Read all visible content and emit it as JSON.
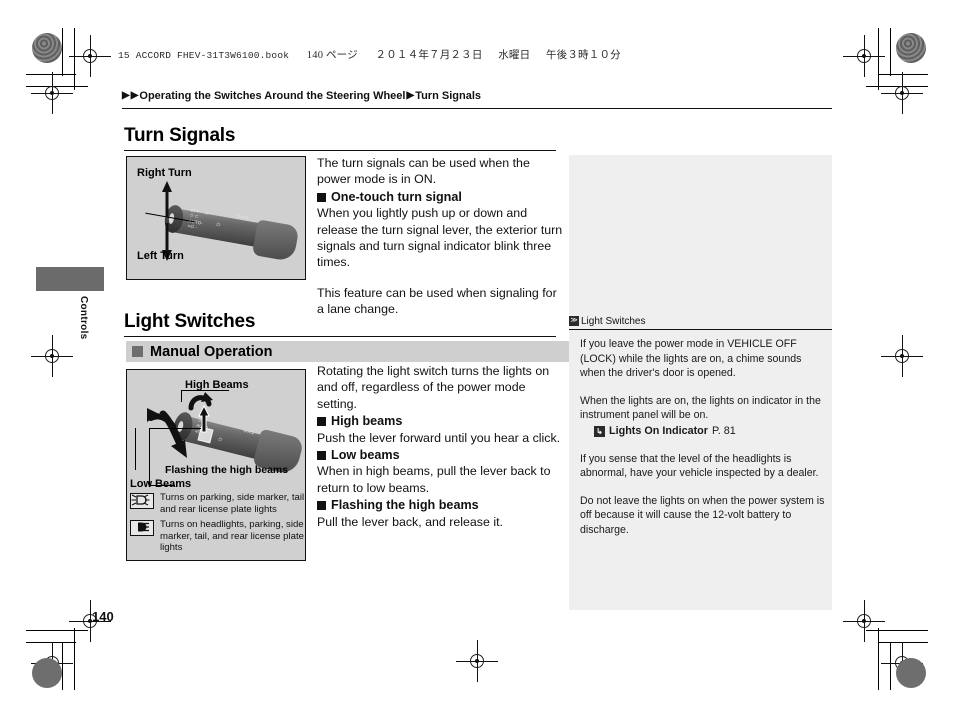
{
  "job_header": {
    "book": "15 ACCORD FHEV-31T3W6100.book",
    "page_marker": "140 ページ",
    "date": "２０１４年７月２３日",
    "weekday": "水曜日",
    "time": "午後３時１０分"
  },
  "breadcrumb": {
    "arrow1": "▶",
    "arrow2": "▶",
    "parent": "Operating the Switches Around the Steering Wheel",
    "arrow3": "▶",
    "current": "Turn Signals"
  },
  "side_tab": {
    "label": "Controls"
  },
  "sections": [
    {
      "id": "turn-signals",
      "title": "Turn Signals",
      "figure": {
        "top_label": "Right Turn",
        "bottom_label": "Left Turn"
      },
      "body": [
        {
          "type": "p",
          "text": "The turn signals can be used when the power mode is in ON."
        },
        {
          "type": "h",
          "text": "One-touch turn signal"
        },
        {
          "type": "p",
          "text": "When you lightly push up or down and release the turn signal lever, the exterior turn signals and turn signal indicator blink three times."
        },
        {
          "type": "gap"
        },
        {
          "type": "p",
          "text": "This feature can be used when signaling for a lane change."
        }
      ]
    },
    {
      "id": "light-switches",
      "title": "Light Switches",
      "subhead": "Manual Operation",
      "figure": {
        "label_high": "High Beams",
        "label_flash": "Flashing the high beams",
        "label_low": "Low Beams"
      },
      "legend": [
        {
          "icon": "parking-lights-icon",
          "text": "Turns on parking, side marker, tail, and rear license plate lights"
        },
        {
          "icon": "headlights-icon",
          "text": "Turns on headlights, parking, side marker, tail, and rear license plate lights"
        }
      ],
      "body": [
        {
          "type": "p",
          "text": "Rotating the light switch turns the lights on and off, regardless of the power mode setting."
        },
        {
          "type": "h",
          "text": "High beams"
        },
        {
          "type": "p",
          "text": "Push the lever forward until you hear a click."
        },
        {
          "type": "h",
          "text": "Low beams"
        },
        {
          "type": "p",
          "text": "When in high beams, pull the lever back to return to low beams."
        },
        {
          "type": "h",
          "text": "Flashing the high beams"
        },
        {
          "type": "p",
          "text": "Pull the lever back, and release it."
        }
      ]
    }
  ],
  "notes_panel": {
    "header_icon": "≫",
    "header_title": "Light Switches",
    "paragraphs": [
      "If you leave the power mode in VEHICLE OFF (LOCK) while the lights are on, a chime sounds when the driver's door is opened.",
      "When the lights are on, the lights on indicator in the instrument panel will be on."
    ],
    "reference": {
      "icon": "↳",
      "label": "Lights On Indicator",
      "page": "P. 81"
    },
    "paragraphs_after": [
      "If you sense that the level of the headlights is abnormal, have your vehicle inspected by a dealer.",
      "Do not leave the lights on when the power system is off because it will cause the 12-volt battery to discharge."
    ]
  },
  "page_number": "140",
  "colors": {
    "figure_bg": "#d0d0d0",
    "subbar_bg": "#cfcfcf",
    "notes_bg": "#efefef",
    "tab_gray": "#6b6b6b",
    "ink": "#111111"
  }
}
